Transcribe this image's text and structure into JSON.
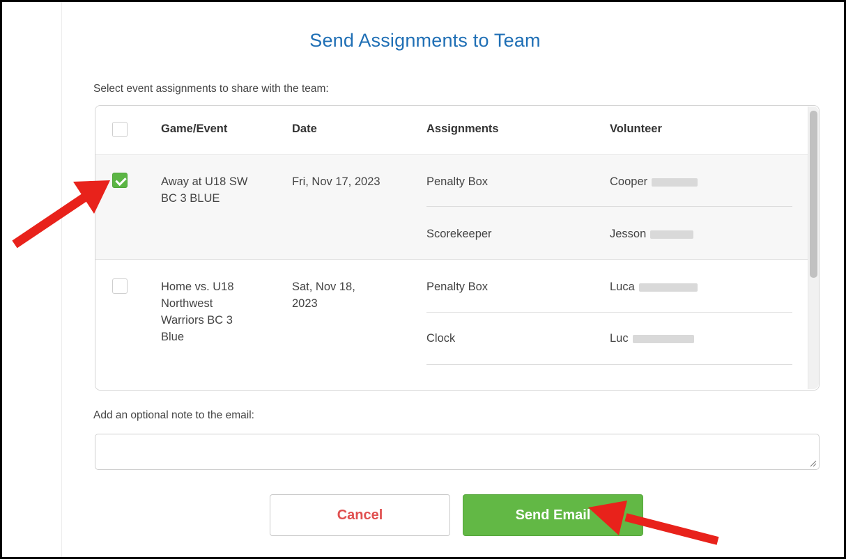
{
  "dialog": {
    "title": "Send Assignments to Team",
    "subtitle": "Select event assignments to share with the team:"
  },
  "table": {
    "headers": {
      "game_event": "Game/Event",
      "date": "Date",
      "assignments": "Assignments",
      "volunteer": "Volunteer"
    },
    "rows": [
      {
        "checked": true,
        "event_lines": [
          "Away at U18 SW",
          "BC 3 BLUE"
        ],
        "date_lines": [
          "Fri, Nov 17, 2023"
        ],
        "assignments": [
          {
            "role": "Penalty Box",
            "volunteer": "Cooper"
          },
          {
            "role": "Scorekeeper",
            "volunteer": "Jesson"
          }
        ]
      },
      {
        "checked": false,
        "event_lines": [
          "Home vs. U18",
          "Northwest",
          "Warriors BC 3",
          "Blue"
        ],
        "date_lines": [
          "Sat, Nov 18,",
          "2023"
        ],
        "assignments": [
          {
            "role": "Penalty Box",
            "volunteer": "Luca"
          },
          {
            "role": "Clock",
            "volunteer": "Luc"
          }
        ]
      }
    ]
  },
  "note": {
    "label": "Add an optional note to the email:",
    "value": ""
  },
  "buttons": {
    "cancel": "Cancel",
    "send": "Send Email"
  },
  "colors": {
    "title": "#1f6fb5",
    "accent_green": "#62b845",
    "cancel_text": "#e05050",
    "annotation_arrow": "#e8221b"
  }
}
